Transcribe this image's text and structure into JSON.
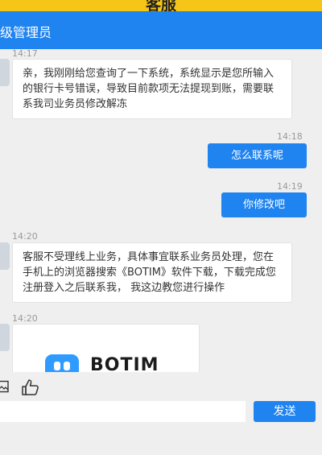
{
  "app": {
    "title": "客服"
  },
  "header": {
    "title": "级管理员"
  },
  "messages": [
    {
      "direction": "in",
      "time": "14:17",
      "text": "亲，我刚刚给您查询了一下系统，系统显示是您所输入的银行卡号错误，导致目前款项无法提现到账，需要联系我司业务员修改解冻"
    },
    {
      "direction": "out",
      "time": "14:18",
      "text": "怎么联系呢"
    },
    {
      "direction": "out",
      "time": "14:19",
      "text": "你修改吧"
    },
    {
      "direction": "in",
      "time": "14:20",
      "text": "客服不受理线上业务，具体事宜联系业务员处理，您在手机上的浏览器搜索《BOTIM》软件下载，下载完成您注册登入之后联系我， 我这边教您进行操作"
    },
    {
      "direction": "in",
      "time": "14:20",
      "type": "image",
      "brand": "BOTIM"
    }
  ],
  "toolbar": {
    "icons": [
      "image-icon",
      "thumbs-up-icon"
    ]
  },
  "composer": {
    "value": "",
    "placeholder": "",
    "send_label": "发送"
  },
  "colors": {
    "accent": "#1f83f0",
    "title_bar": "#f5c518",
    "background": "#efefef"
  }
}
